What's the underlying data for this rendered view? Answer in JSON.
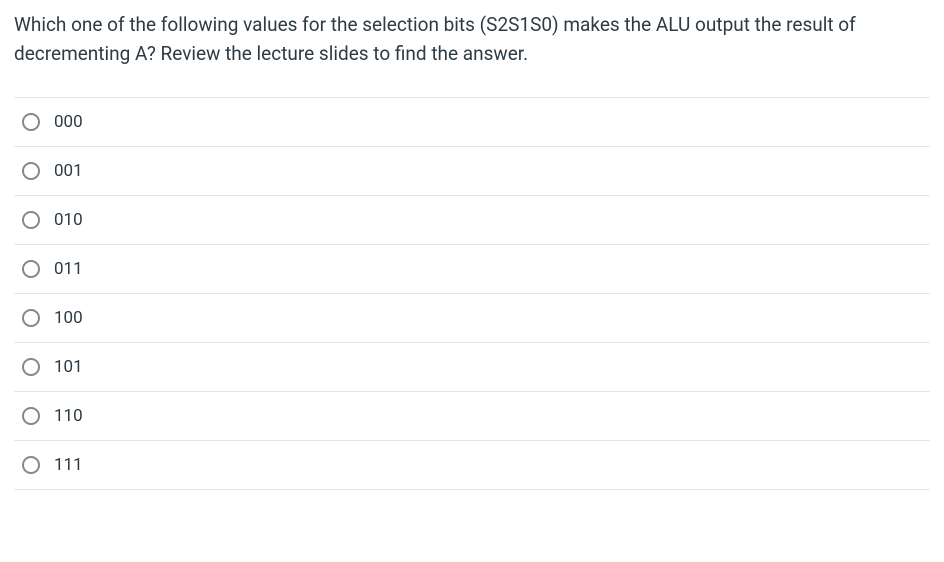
{
  "question": {
    "text": "Which one of the following values for the selection bits (S2S1S0) makes the ALU output the result of decrementing A? Review the lecture slides to find the answer."
  },
  "options": [
    {
      "label": "000"
    },
    {
      "label": "001"
    },
    {
      "label": "010"
    },
    {
      "label": "011"
    },
    {
      "label": "100"
    },
    {
      "label": "101"
    },
    {
      "label": "110"
    },
    {
      "label": "111"
    }
  ]
}
